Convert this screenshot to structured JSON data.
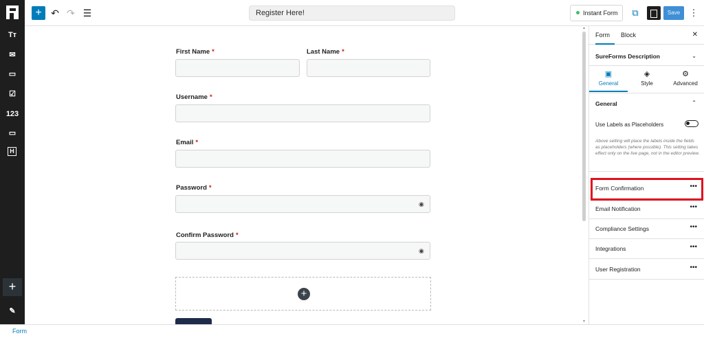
{
  "toolbar": {
    "add_label": "+",
    "undo_icon": "undo-icon",
    "redo_icon": "redo-icon",
    "list_view_icon": "list-view-icon",
    "document_title": "Register Here!",
    "instant_form_label": "Instant Form",
    "save_label": "Save",
    "more_icon": "more-vertical-icon"
  },
  "left_sidebar": {
    "items": [
      {
        "label": "Tт",
        "icon": "heading-icon"
      },
      {
        "label": "✉",
        "icon": "email-icon"
      },
      {
        "label": "▭",
        "icon": "textarea-icon"
      },
      {
        "label": "☑",
        "icon": "checkbox-icon"
      },
      {
        "label": "123",
        "icon": "number-icon"
      },
      {
        "label": "▭",
        "icon": "dropdown-icon"
      },
      {
        "label": "H",
        "icon": "hidden-field-icon"
      }
    ],
    "add_label": "+",
    "edit_icon": "pencil-icon"
  },
  "form": {
    "first_name_label": "First Name",
    "last_name_label": "Last Name",
    "username_label": "Username",
    "email_label": "Email",
    "password_label": "Password",
    "confirm_password_label": "Confirm Password",
    "required_mark": "*",
    "add_block_label": "+"
  },
  "settings_panel": {
    "tab_form": "Form",
    "tab_block": "Block",
    "close_label": "✕",
    "description_title": "SureForms Description",
    "subtabs": [
      {
        "label": "General"
      },
      {
        "label": "Style"
      },
      {
        "label": "Advanced"
      }
    ],
    "general_title": "General",
    "labels_as_placeholders": "Use Labels as Placeholders",
    "help_text": "Above setting will place the labels inside the fields as placeholders (where possible). This setting takes effect only on the live page, not in the editor preview.",
    "rows": [
      {
        "label": "Form Confirmation"
      },
      {
        "label": "Email Notification"
      },
      {
        "label": "Compliance Settings"
      },
      {
        "label": "Integrations"
      },
      {
        "label": "User Registration"
      }
    ],
    "dots_label": "•••"
  },
  "footer": {
    "breadcrumb": "Form"
  },
  "colors": {
    "accent": "#007cba",
    "highlight": "#e0101f",
    "required": "#cc1818"
  }
}
